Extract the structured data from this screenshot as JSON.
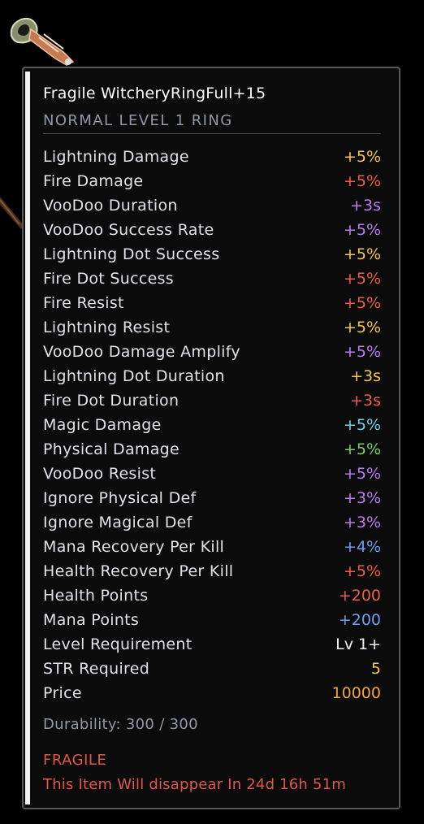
{
  "colors": {
    "yellow": "#f2c64c",
    "red": "#ef5a4a",
    "purple": "#b97cf2",
    "cyan": "#6fd1ea",
    "green": "#7fce64",
    "blue": "#6f9cf2",
    "white": "#f2f2f2",
    "orange": "#f2a63c"
  },
  "item": {
    "icon": "ring-cursor-icon",
    "title": "Fragile WitcheryRingFull+15",
    "subtitle": "NORMAL LEVEL 1 RING"
  },
  "stats": [
    {
      "label": "Lightning Damage",
      "value": "+5%",
      "color": "#f2c64c"
    },
    {
      "label": "Fire Damage",
      "value": "+5%",
      "color": "#ef5a4a"
    },
    {
      "label": "VooDoo Duration",
      "value": "+3s",
      "color": "#b97cf2"
    },
    {
      "label": "VooDoo Success Rate",
      "value": "+5%",
      "color": "#b97cf2"
    },
    {
      "label": "Lightning Dot Success",
      "value": "+5%",
      "color": "#f2c64c"
    },
    {
      "label": "Fire Dot Success",
      "value": "+5%",
      "color": "#ef5a4a"
    },
    {
      "label": "Fire Resist",
      "value": "+5%",
      "color": "#ef5a4a"
    },
    {
      "label": "Lightning Resist",
      "value": "+5%",
      "color": "#f2c64c"
    },
    {
      "label": "VooDoo Damage Amplify",
      "value": "+5%",
      "color": "#b97cf2"
    },
    {
      "label": "Lightning Dot Duration",
      "value": "+3s",
      "color": "#f2c64c"
    },
    {
      "label": "Fire Dot Duration",
      "value": "+3s",
      "color": "#ef5a4a"
    },
    {
      "label": "Magic Damage",
      "value": "+5%",
      "color": "#6fd1ea"
    },
    {
      "label": "Physical Damage",
      "value": "+5%",
      "color": "#7fce64"
    },
    {
      "label": "VooDoo Resist",
      "value": "+5%",
      "color": "#b97cf2"
    },
    {
      "label": "Ignore Physical Def",
      "value": "+3%",
      "color": "#b97cf2"
    },
    {
      "label": "Ignore Magical Def",
      "value": "+3%",
      "color": "#b97cf2"
    },
    {
      "label": "Mana Recovery Per Kill",
      "value": "+4%",
      "color": "#6f9cf2"
    },
    {
      "label": "Health Recovery Per Kill",
      "value": "+5%",
      "color": "#ef5a4a"
    },
    {
      "label": "Health Points",
      "value": "+200",
      "color": "#ef5a4a"
    },
    {
      "label": "Mana Points",
      "value": "+200",
      "color": "#6f9cf2"
    },
    {
      "label": "Level Requirement",
      "value": "Lv 1+",
      "color": "#f2f2f2"
    },
    {
      "label": "STR Required",
      "value": "5",
      "color": "#f2c64c"
    },
    {
      "label": "Price",
      "value": "10000",
      "color": "#f2a63c"
    }
  ],
  "durability": "Durability: 300 / 300",
  "fragile_label": "FRAGILE",
  "expire_text": "This Item Will disappear In 24d 16h 51m"
}
